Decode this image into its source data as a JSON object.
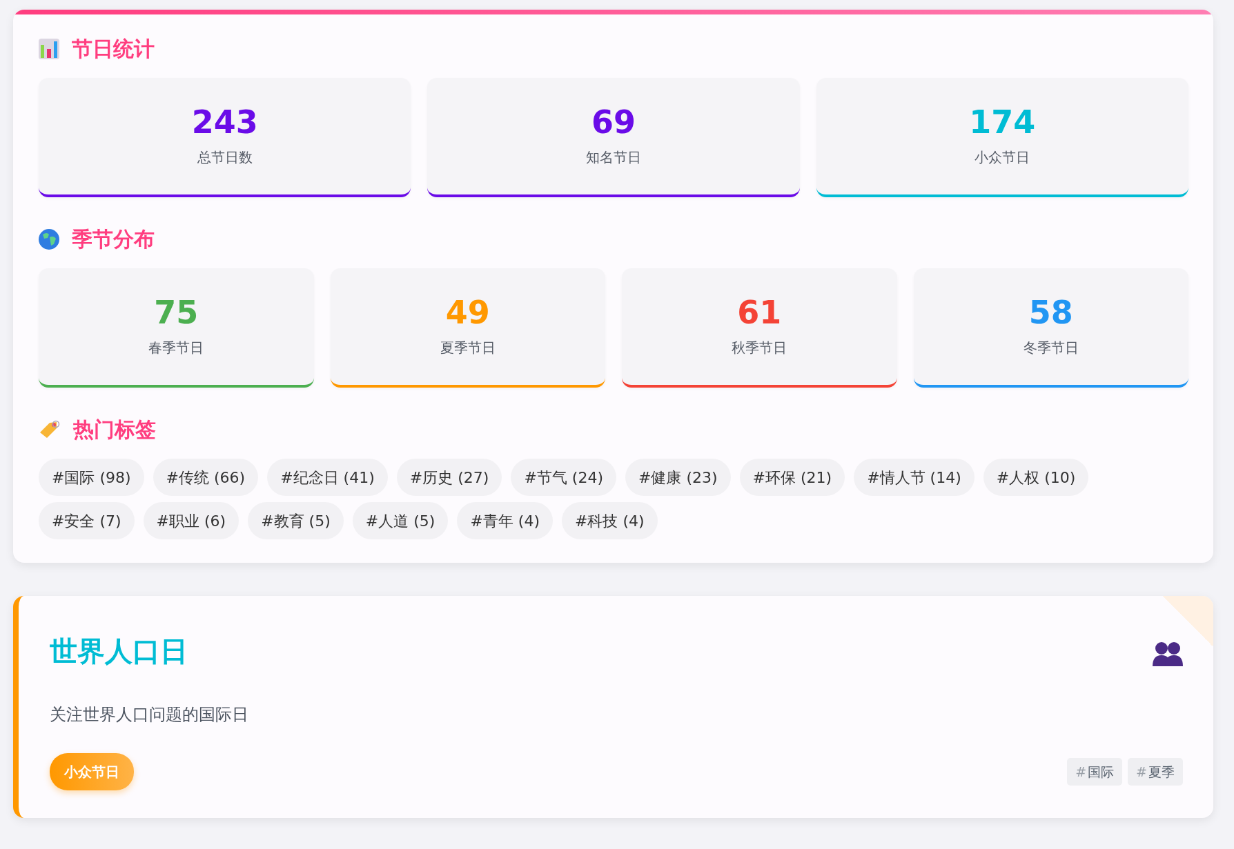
{
  "stats_section": {
    "title": "节日统计",
    "items": [
      {
        "value": "243",
        "label": "总节日数",
        "color": "#6a0be8"
      },
      {
        "value": "69",
        "label": "知名节日",
        "color": "#6a0be8"
      },
      {
        "value": "174",
        "label": "小众节日",
        "color": "#00bcd4"
      }
    ]
  },
  "season_section": {
    "title": "季节分布",
    "items": [
      {
        "value": "75",
        "label": "春季节日",
        "color": "#4caf50"
      },
      {
        "value": "49",
        "label": "夏季节日",
        "color": "#ff9800"
      },
      {
        "value": "61",
        "label": "秋季节日",
        "color": "#f44336"
      },
      {
        "value": "58",
        "label": "冬季节日",
        "color": "#2196f3"
      }
    ]
  },
  "tags_section": {
    "title": "热门标签",
    "tags": [
      "#国际 (98)",
      "#传统 (66)",
      "#纪念日 (41)",
      "#历史 (27)",
      "#节气 (24)",
      "#健康 (23)",
      "#环保 (21)",
      "#情人节 (14)",
      "#人权 (10)",
      "#安全 (7)",
      "#职业 (6)",
      "#教育 (5)",
      "#人道 (5)",
      "#青年 (4)",
      "#科技 (4)"
    ]
  },
  "festival_card": {
    "title": "世界人口日",
    "description": "关注世界人口问题的国际日",
    "badge": "小众节日",
    "tags": [
      {
        "hash": "#",
        "label": "国际"
      },
      {
        "hash": "#",
        "label": "夏季"
      }
    ]
  }
}
